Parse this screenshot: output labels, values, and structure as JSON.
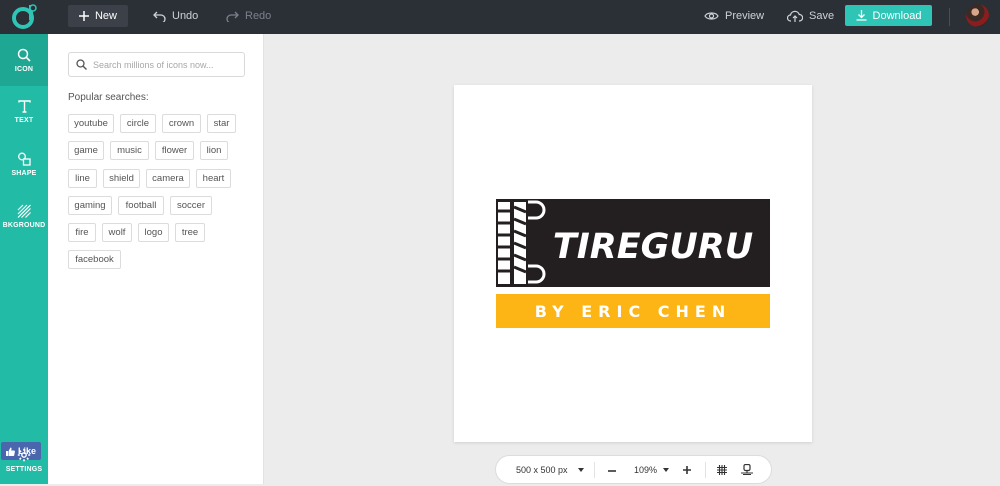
{
  "topbar": {
    "new_label": "New",
    "undo_label": "Undo",
    "redo_label": "Redo",
    "preview_label": "Preview",
    "save_label": "Save",
    "download_label": "Download"
  },
  "siderail": {
    "items": [
      {
        "label": "ICON",
        "icon": "search-icon"
      },
      {
        "label": "TEXT",
        "icon": "text-icon"
      },
      {
        "label": "SHAPE",
        "icon": "shapes-icon"
      },
      {
        "label": "BKGROUND",
        "icon": "hatch-icon"
      }
    ],
    "like_label": "Like",
    "settings_label": "SETTINGS"
  },
  "panel": {
    "search_placeholder": "Search millions of icons now...",
    "popular_title": "Popular searches:",
    "tags": [
      "youtube",
      "circle",
      "crown",
      "star",
      "game",
      "music",
      "flower",
      "lion",
      "line",
      "shield",
      "camera",
      "heart",
      "gaming",
      "football",
      "soccer",
      "fire",
      "wolf",
      "logo",
      "tree",
      "facebook"
    ]
  },
  "artwork": {
    "brand_name": "TIREGURU",
    "tagline": "BY ERIC CHEN",
    "colors": {
      "dark": "#231f20",
      "accent": "#fdb515",
      "text": "#ffffff"
    }
  },
  "zoombar": {
    "size_label": "500 x 500 px",
    "zoom_label": "109%"
  },
  "colors": {
    "topbar": "#2b2f36",
    "rail": "#22bba6",
    "download": "#2ec4b6"
  }
}
